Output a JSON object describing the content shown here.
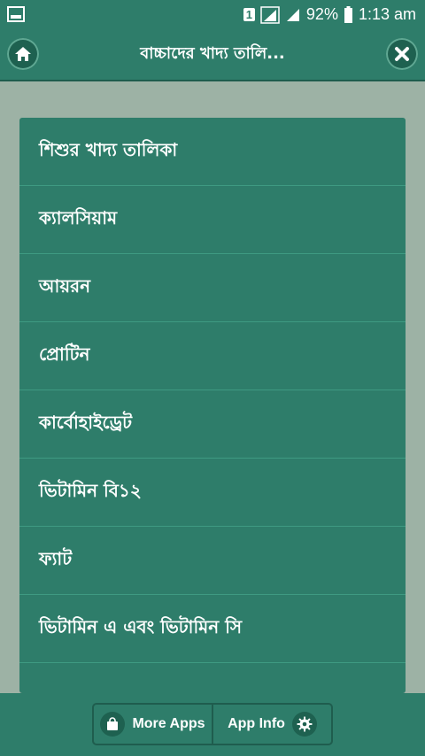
{
  "status_bar": {
    "sim_label": "1",
    "battery": "92%",
    "time": "1:13 am"
  },
  "app_bar": {
    "title": "বাচ্চাদের খাদ্য তালি..."
  },
  "list": {
    "items": [
      "শিশুর খাদ্য তালিকা",
      "ক্যালসিয়াম",
      "আয়রন",
      "প্রোটিন",
      "কার্বোহাইড্রেট",
      "ভিটামিন বি১২",
      "ফ্যাট",
      "ভিটামিন এ এবং ভিটামিন সি"
    ]
  },
  "bottom_bar": {
    "more_apps_label": "More Apps",
    "app_info_label": "App Info"
  },
  "colors": {
    "primary": "#2e7d6a",
    "background": "#9db2a5"
  },
  "icons": [
    "home-icon",
    "close-icon",
    "shopping-bag-icon",
    "gear-icon",
    "signal-icon",
    "battery-icon"
  ]
}
